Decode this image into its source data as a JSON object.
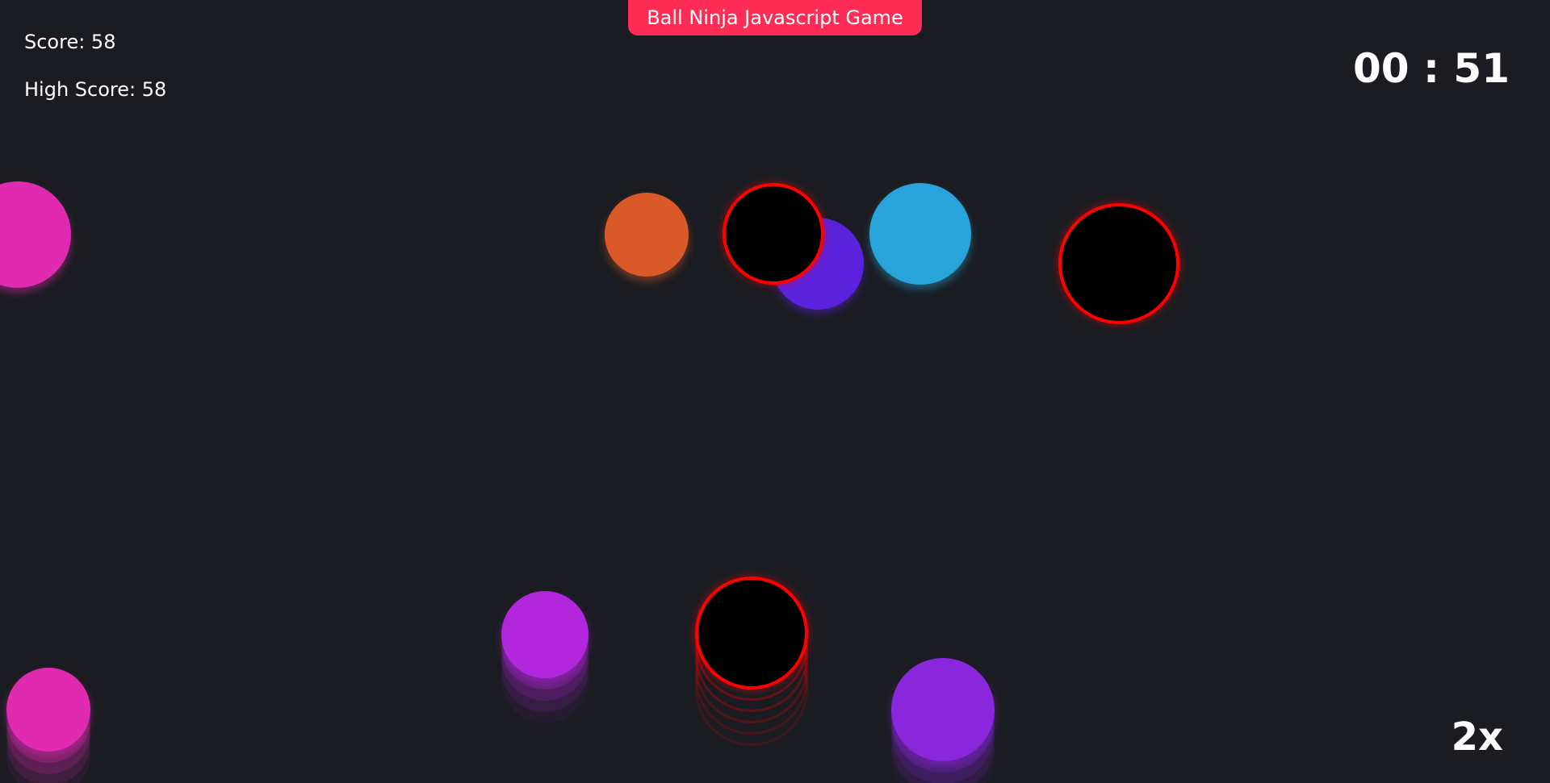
{
  "game": {
    "title": "Ball Ninja Javascript Game",
    "score_label": "Score: 58",
    "high_score_label": "High Score: 58",
    "timer": "00 : 51",
    "multiplier": "2x"
  },
  "colors": {
    "background": "#1a1c21",
    "title_badge": "#ff2d55",
    "text": "#ffffff",
    "bomb_fill": "#000000",
    "bomb_ring": "#ff0000"
  },
  "balls": [
    {
      "kind": "ball",
      "color": "#e02bb0"
    },
    {
      "kind": "ball",
      "color": "#d95a28"
    },
    {
      "kind": "ball",
      "color": "#5a22dc"
    },
    {
      "kind": "bomb",
      "color": "#000000"
    },
    {
      "kind": "ball",
      "color": "#29a4da"
    },
    {
      "kind": "bomb",
      "color": "#000000"
    },
    {
      "kind": "ball",
      "color": "#e02bb0"
    },
    {
      "kind": "ball",
      "color": "#b226dc"
    },
    {
      "kind": "bomb",
      "color": "#000000"
    },
    {
      "kind": "ball",
      "color": "#8a26dc"
    }
  ]
}
